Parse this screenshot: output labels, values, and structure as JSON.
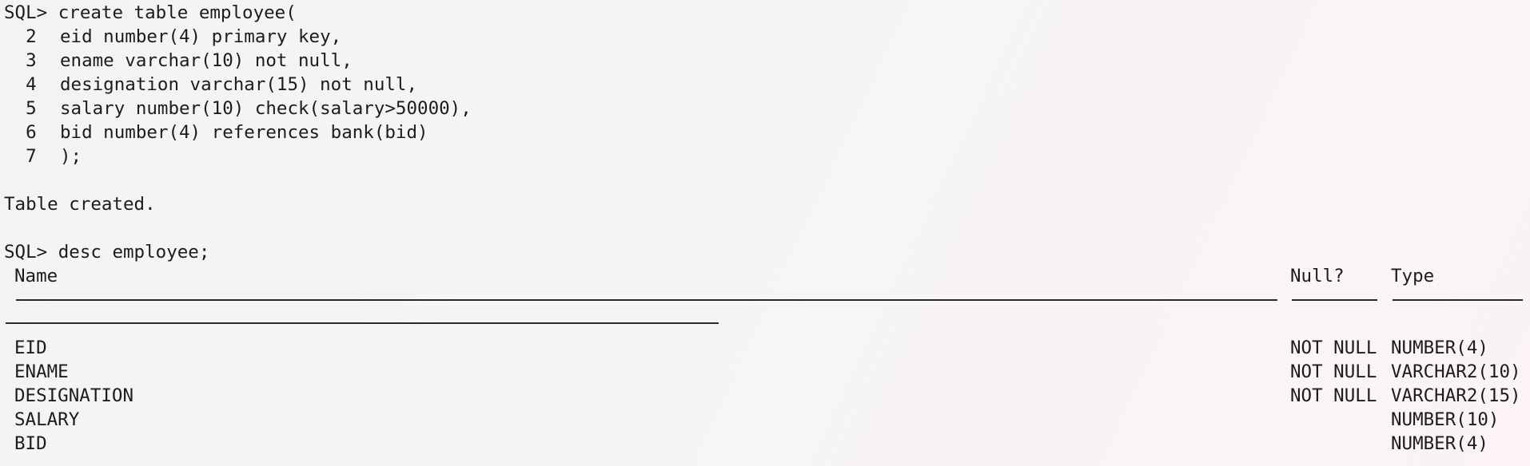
{
  "prompt": "SQL> ",
  "create_statement": {
    "first_line": "create table employee(",
    "continuation_lines": [
      {
        "no": "  2",
        "text": "eid number(4) primary key,"
      },
      {
        "no": "  3",
        "text": "ename varchar(10) not null,"
      },
      {
        "no": "  4",
        "text": "designation varchar(15) not null,"
      },
      {
        "no": "  5",
        "text": "salary number(10) check(salary>50000),"
      },
      {
        "no": "  6",
        "text": "bid number(4) references bank(bid)"
      },
      {
        "no": "  7",
        "text": ");"
      }
    ]
  },
  "result_message": "Table created.",
  "desc_command": "desc employee;",
  "describe": {
    "headers": {
      "name": "Name",
      "null": "Null?",
      "type": "Type"
    },
    "rows": [
      {
        "name": "EID",
        "null": "NOT NULL",
        "type": "NUMBER(4)"
      },
      {
        "name": "ENAME",
        "null": "NOT NULL",
        "type": "VARCHAR2(10)"
      },
      {
        "name": "DESIGNATION",
        "null": "NOT NULL",
        "type": "VARCHAR2(15)"
      },
      {
        "name": "SALARY",
        "null": "",
        "type": "NUMBER(10)"
      },
      {
        "name": "BID",
        "null": "",
        "type": "NUMBER(4)"
      }
    ]
  }
}
